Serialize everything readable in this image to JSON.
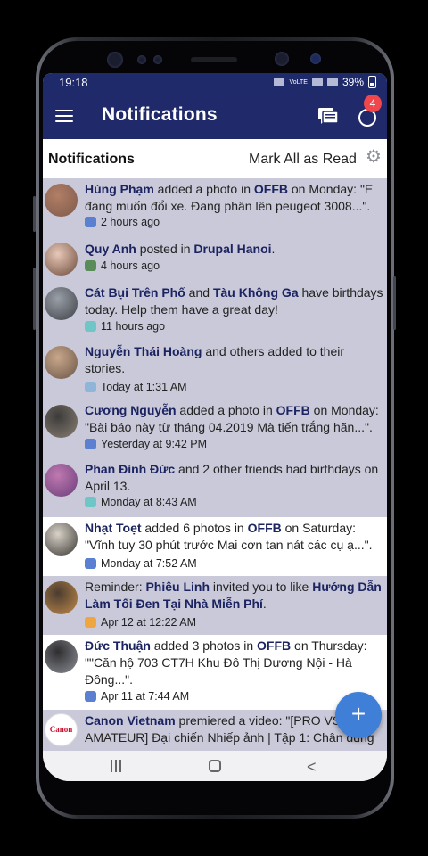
{
  "status_bar": {
    "time": "19:18",
    "volte": "VoLTE",
    "battery": "39%"
  },
  "app_bar": {
    "title": "Notifications",
    "badge_count": "4"
  },
  "subheader": {
    "title": "Notifications",
    "mark_all": "Mark All as Read"
  },
  "colors": {
    "appbar": "#202a6a",
    "unread_bg": "#c9c9d9",
    "fab": "#3f7fd8",
    "badge": "#f2464d"
  },
  "notifications": [
    {
      "parts": [
        {
          "b": "Hùng Phạm"
        },
        {
          "t": " added a photo in "
        },
        {
          "b": "OFFB"
        },
        {
          "t": " on Monday: \"E đang muốn đổi xe. Đang phân lên peugeot 3008...\"."
        }
      ],
      "time": "2 hours ago",
      "icon": "group-icon",
      "unread": true
    },
    {
      "parts": [
        {
          "b": "Quy Anh"
        },
        {
          "t": " posted in "
        },
        {
          "b": "Drupal Hanoi"
        },
        {
          "t": "."
        }
      ],
      "time": "4 hours ago",
      "icon": "page-icon",
      "unread": true
    },
    {
      "parts": [
        {
          "b": "Cát Bụi Trên Phố"
        },
        {
          "t": " and "
        },
        {
          "b": "Tàu Không Ga"
        },
        {
          "t": " have birthdays today. Help them have a great day!"
        }
      ],
      "time": "11 hours ago",
      "icon": "birthday-icon",
      "unread": true
    },
    {
      "parts": [
        {
          "b": "Nguyễn Thái Hoàng"
        },
        {
          "t": " and others added to their stories."
        }
      ],
      "time": "Today at 1:31 AM",
      "icon": "photo-icon",
      "unread": true
    },
    {
      "parts": [
        {
          "b": "Cương Nguyễn"
        },
        {
          "t": " added a photo in "
        },
        {
          "b": "OFFB"
        },
        {
          "t": " on Monday: \"Bài báo này từ tháng 04.2019 Mà tiến trắng hãn...\"."
        }
      ],
      "time": "Yesterday at 9:42 PM",
      "icon": "group-icon",
      "unread": true
    },
    {
      "parts": [
        {
          "b": "Phan Đình Đức"
        },
        {
          "t": " and 2 other friends had birthdays on April 13."
        }
      ],
      "time": "Monday at 8:43 AM",
      "icon": "birthday-icon",
      "unread": true
    },
    {
      "parts": [
        {
          "b": "Nhạt Toẹt"
        },
        {
          "t": " added 6 photos in "
        },
        {
          "b": "OFFB"
        },
        {
          "t": " on Saturday: \"Vĩnh tuy 30 phút trước Mai cơn tan nát các cụ ạ...\"."
        }
      ],
      "time": "Monday at 7:52 AM",
      "icon": "group-icon",
      "unread": false
    },
    {
      "parts": [
        {
          "t": "Reminder: "
        },
        {
          "b": "Phiêu Linh"
        },
        {
          "t": " invited you to like "
        },
        {
          "b": "Hướng Dẫn Làm Tối Đen Tại Nhà Miễn Phí"
        },
        {
          "t": "."
        }
      ],
      "time": "Apr 12 at 12:22 AM",
      "icon": "flag-icon",
      "unread": true
    },
    {
      "parts": [
        {
          "b": "Đức Thuận"
        },
        {
          "t": " added 3 photos in "
        },
        {
          "b": "OFFB"
        },
        {
          "t": " on Thursday: \"\"Căn hộ 703 CT7H Khu Đô Thị Dương Nội - Hà Đông...\"."
        }
      ],
      "time": "Apr 11 at 7:44 AM",
      "icon": "group-icon",
      "unread": false
    },
    {
      "parts": [
        {
          "b": "Canon Vietnam"
        },
        {
          "t": " premiered a video: \"[PRO VS AMATEUR] Đại chiến Nhiếp ảnh | Tập 1: Chân dung"
        }
      ],
      "time": "",
      "icon": "video-icon",
      "unread": true,
      "avatar_text": "Canon"
    }
  ]
}
